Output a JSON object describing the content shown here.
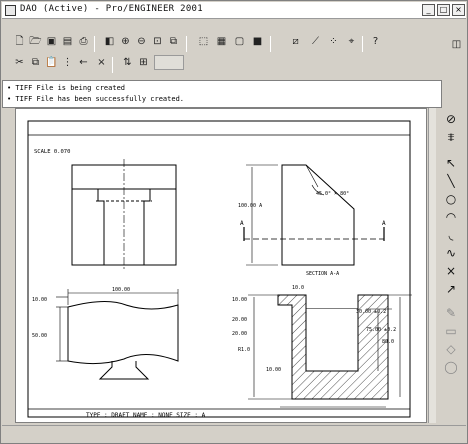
{
  "window": {
    "title": "DAO (Active) - Pro/ENGINEER 2001",
    "minimize_label": "_",
    "maximize_label": "□",
    "close_label": "×"
  },
  "messages": [
    "• TIFF File is being created",
    "• TIFF File has been successfully created."
  ],
  "drawing": {
    "scale_note": "SCALE  0.070",
    "section_label": "SECTION  A-A",
    "cut_left": "A",
    "cut_right": "A",
    "angle_dim": "45.0° × 80°",
    "dims": {
      "vertical_right": "100.00 A",
      "top_width": "100.00",
      "left_height_top": "10.00",
      "left_height": "50.00",
      "mid_left": "50.00",
      "r_a": "10.0",
      "r_b": "10.00",
      "r_c": "20.00",
      "r_d": "30.00 ±0.2",
      "r_e": "75.00 ±0.2",
      "r_f": "20.00",
      "r_g": "80.0",
      "r_h": "R1.0",
      "r_i": "10.00"
    },
    "title_block": "TYPE : DRAFT  NAME : NONE  SIZE : A"
  },
  "colors": {
    "chrome": "#d4d0c8",
    "canvas": "#ffffff",
    "ink": "#000000"
  }
}
